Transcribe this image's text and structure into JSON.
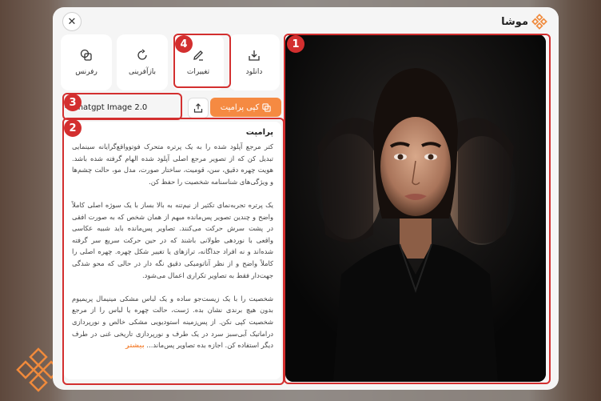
{
  "brand": {
    "name": "موشا"
  },
  "actions": [
    {
      "label": "دانلود",
      "icon": "download-icon"
    },
    {
      "label": "تغییرات",
      "icon": "edit-icon"
    },
    {
      "label": "بازآفرینی",
      "icon": "regenerate-icon"
    },
    {
      "label": "رفرنس",
      "icon": "reference-icon"
    }
  ],
  "model": {
    "name": "Chatgpt Image 2.0"
  },
  "copy_prompt": {
    "label": "کپی پرامپت"
  },
  "prompt": {
    "title": "پرامپت",
    "text": "کتر مرجع آپلود شده را به یک پرتره متحرک فوتوواقع‌گرایانه سینمایی تبدیل کن که از تصویر مرجع اصلی آپلود شده الهام گرفته شده باشد. هویت چهره دقیق، سن، قومیت، ساختار صورت، مدل مو، حالت چشم‌ها و ویژگی‌های شناسنامه شخصیت را حفظ کن.\n\nیک پرتره تجربه‌نمای تکثیر از نیم‌تنه به بالا بساز با یک سوژه اصلی کاملاً واضح و چندین تصویر پس‌مانده مبهم از همان شخص که به صورت افقی در پشت سرش حرکت می‌کنند. تصاویر پس‌مانده باید شبیه عکاسی واقعی با نوردهی طولانی باشند که در حین حرکت سریع سر گرفته شده‌اند و نه افراد جداگانه، ترازهای یا تغییر شکل چهره. چهره اصلی را کاملاً واضح و از نظر آناتومیکی دقیق نگه دار در حالی که محو شدگی جهت‌دار فقط به تصاویر تکراری اعمال می‌شود.\n\nشخصیت را با یک زیست‌جو ساده و یک لباس مشکی مینیمال پریمیوم بدون هیچ برندی نشان بده. ژست، حالت چهره یا لباس را از مرجع شخصیت کپی نکن. از پس‌زمینه استودیویی مشکی خالص و نورپردازی دراماتیک آبی‌سبز سرد در یک طرف و نورپردازی تاریخی غنی در طرف دیگر استفاده کن. اجازه بده تصاویر پس‌ماند...",
    "more": "بیشتر"
  },
  "annotations": [
    "1",
    "2",
    "3",
    "4"
  ],
  "colors": {
    "accent": "#f58a42",
    "annotation": "#d32f2f"
  }
}
